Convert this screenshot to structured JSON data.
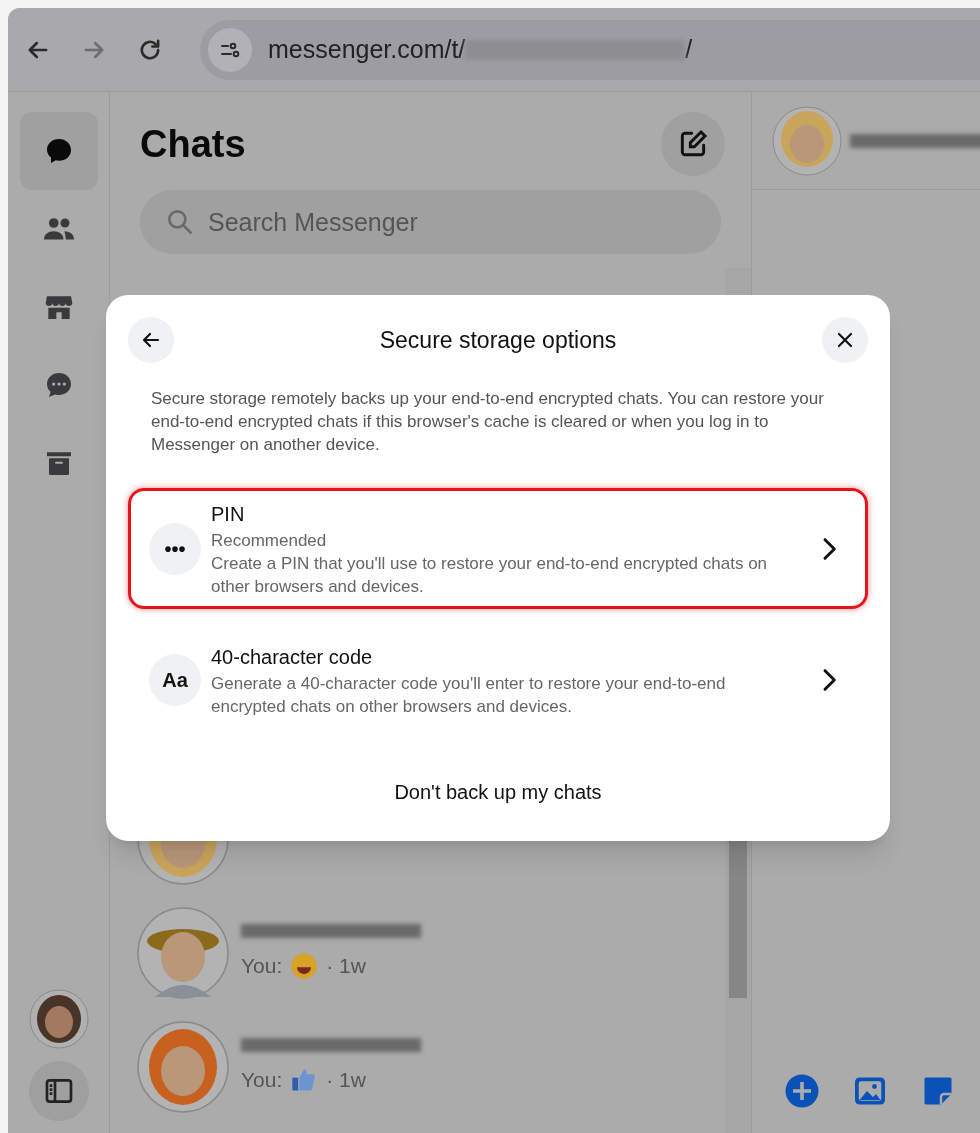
{
  "browser": {
    "url": "messenger.com/t/",
    "url_end": "/"
  },
  "rail": [
    {
      "selected": true
    },
    {
      "selected": false
    },
    {
      "selected": false
    },
    {
      "selected": false
    },
    {
      "selected": false
    }
  ],
  "chats": {
    "title": "Chats",
    "search": {
      "placeholder": "Search Messenger"
    },
    "rows": [
      {
        "kind": "partial"
      },
      {
        "kind": "farmer",
        "prefix": "You:",
        "meta": "· 1w"
      },
      {
        "kind": "redhead",
        "prefix": "You:",
        "meta": "· 1w"
      }
    ]
  },
  "dialog": {
    "title": "Secure storage options",
    "description": "Secure storage remotely backs up your end-to-end encrypted chats. You can restore your end-to-end encrypted chats if this browser's cache is cleared or when you log in to Messenger on another device.",
    "options": [
      {
        "icon": "•••",
        "title": "PIN",
        "subtitle": "Recommended",
        "description": "Create a PIN that you'll use to restore your end-to-end encrypted chats on other browsers and devices.",
        "highlighted": true
      },
      {
        "icon": "Aa",
        "title": "40-character code",
        "description": "Generate a 40-character code you'll enter to restore your end-to-end encrypted chats on other browsers and devices.",
        "highlighted": false
      }
    ],
    "footer_button": "Don't back up my chats"
  }
}
